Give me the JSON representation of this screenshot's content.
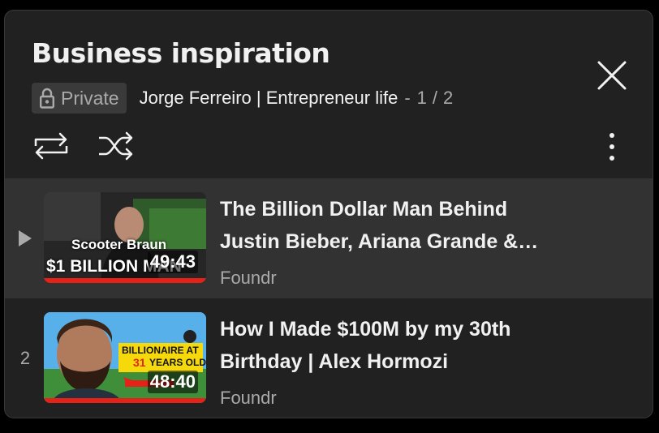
{
  "playlist": {
    "title": "Business inspiration",
    "privacy_label": "Private",
    "owner": "Jorge Ferreiro | Entrepreneur life",
    "separator": "-",
    "position_current": "1",
    "position_slash": "/",
    "position_total": "2"
  },
  "controls": {
    "loop_icon": "loop-icon",
    "shuffle_icon": "shuffle-icon",
    "more_icon": "more-vert-icon",
    "close_icon": "close-icon"
  },
  "videos": [
    {
      "index": "",
      "now_playing_icon": "play-arrow-icon",
      "title": "The Billion Dollar Man Behind Justin Bieber, Ariana Grande & Kanye West",
      "channel": "Foundr",
      "duration": "49:43",
      "thumb_caption_top": "Scooter Braun",
      "thumb_caption_bottom": "$1 BILLION MAN",
      "progress_fraction": 1.0
    },
    {
      "index": "2",
      "title": "How I Made $100M by my 30th Birthday | Alex Hormozi",
      "channel": "Foundr",
      "duration": "48:40",
      "thumb_caption_top": "BILLIONAIRE AT",
      "thumb_caption_bottom": "YEARS OLD?",
      "thumb_caption_number": "31",
      "progress_fraction": 1.0
    }
  ],
  "colors": {
    "panel_bg": "#212121",
    "active_row_bg": "#323232",
    "progress_red": "#e62117",
    "secondary_text": "#aaaaaa"
  }
}
